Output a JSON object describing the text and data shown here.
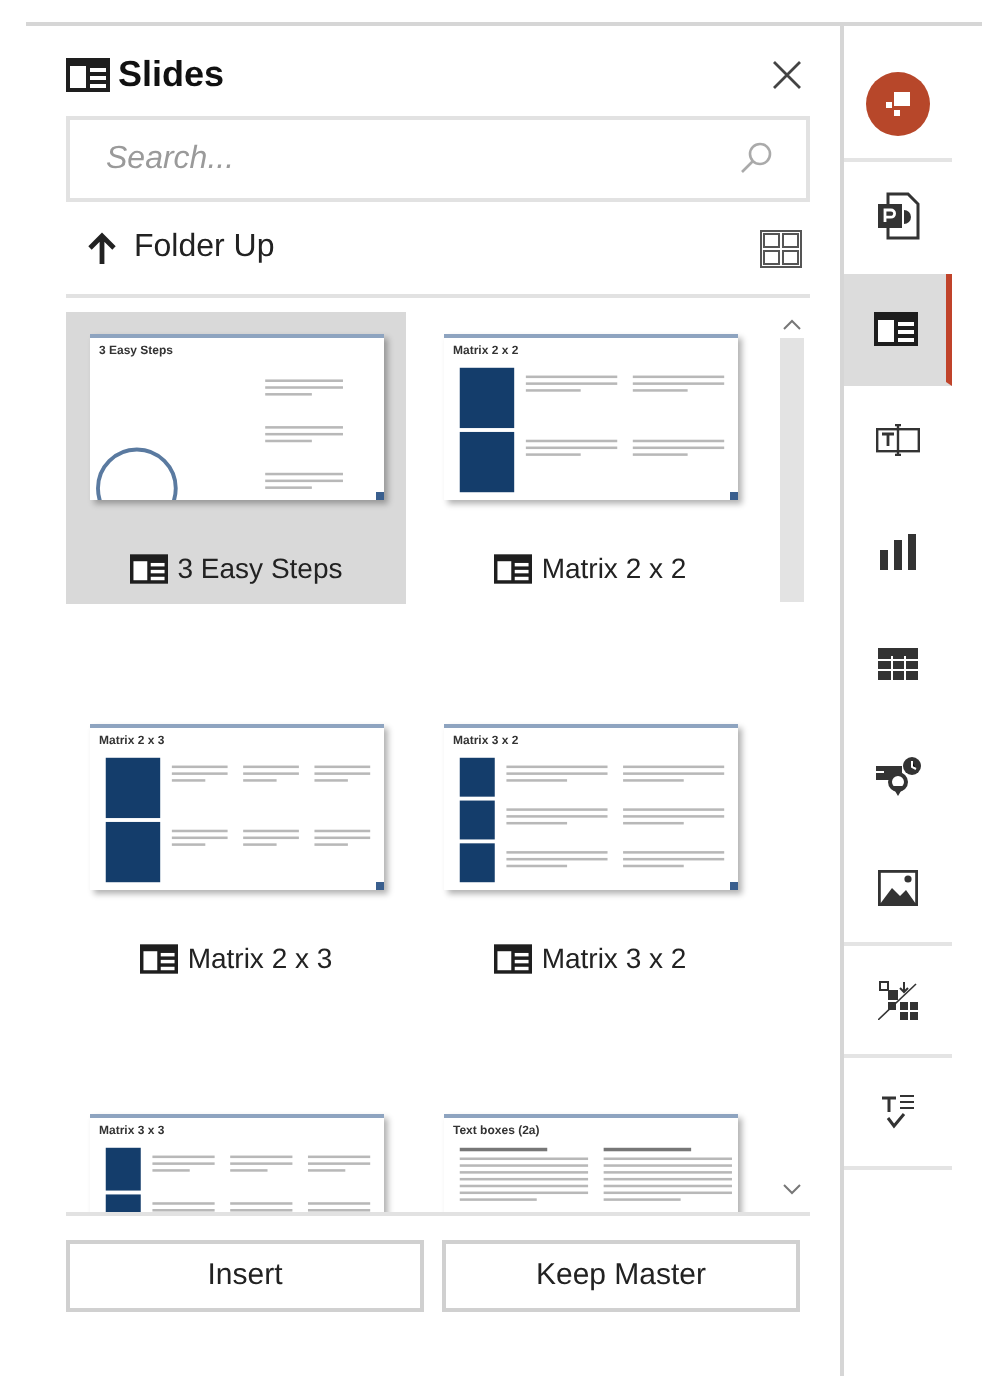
{
  "panel": {
    "title": "Slides",
    "search": {
      "placeholder": "Search..."
    },
    "folder_up": "Folder Up"
  },
  "slides": [
    {
      "kind": "steps",
      "title": "3 Easy Steps",
      "label": "3 Easy Steps",
      "selected": true
    },
    {
      "kind": "matrix-2x2",
      "title": "Matrix 2 x 2",
      "label": "Matrix 2 x 2",
      "selected": false
    },
    {
      "kind": "matrix-2x3",
      "title": "Matrix 2 x 3",
      "label": "Matrix 2 x 3",
      "selected": false
    },
    {
      "kind": "matrix-3x2",
      "title": "Matrix 3 x 2",
      "label": "Matrix 3 x 2",
      "selected": false
    },
    {
      "kind": "matrix-3x3",
      "title": "Matrix 3 x 3",
      "selected": false
    },
    {
      "kind": "text-boxes",
      "title": "Text boxes (2a)",
      "selected": false
    }
  ],
  "buttons": [
    {
      "label": "Insert"
    },
    {
      "label": "Keep Master"
    }
  ],
  "sidebar": {
    "items": [
      {
        "kind": "logo",
        "selected": false,
        "separator_after": true
      },
      {
        "kind": "presentation",
        "selected": false,
        "separator_after": false
      },
      {
        "kind": "slides",
        "selected": true,
        "separator_after": false
      },
      {
        "kind": "textbox",
        "selected": false,
        "separator_after": false
      },
      {
        "kind": "chart",
        "selected": false,
        "separator_after": false
      },
      {
        "kind": "table",
        "selected": false,
        "separator_after": false
      },
      {
        "kind": "map",
        "selected": false,
        "separator_after": false
      },
      {
        "kind": "picture",
        "selected": false,
        "separator_after": true
      },
      {
        "kind": "smart",
        "selected": false,
        "separator_after": true
      },
      {
        "kind": "text-check",
        "selected": false,
        "separator_after": true
      }
    ]
  }
}
